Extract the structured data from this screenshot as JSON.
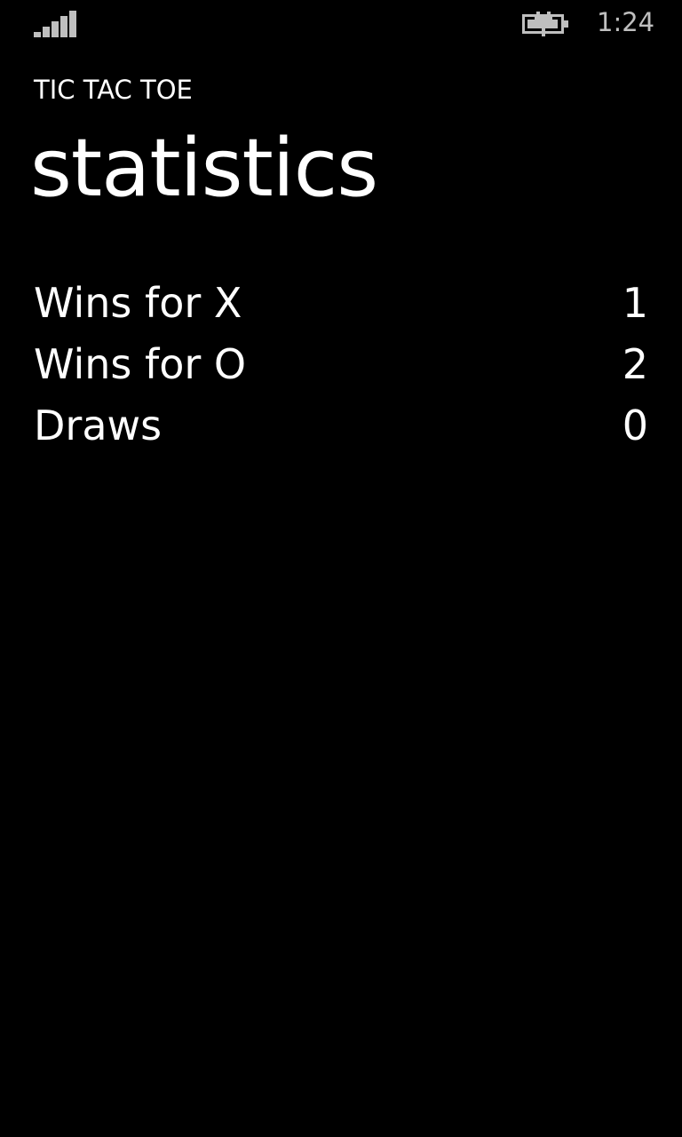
{
  "status_bar": {
    "time": "1:24",
    "signal_icon": "signal-strength-icon",
    "battery_icon": "battery-charging-icon",
    "signal_level": 1.0
  },
  "app": {
    "title": "TIC TAC TOE"
  },
  "page": {
    "title": "statistics"
  },
  "stats": [
    {
      "label": "Wins for X",
      "value": "1"
    },
    {
      "label": "Wins for O",
      "value": "2"
    },
    {
      "label": "Draws",
      "value": "0"
    }
  ],
  "colors": {
    "background": "#000000",
    "text": "#ffffff",
    "status_text": "#bfbfbf"
  }
}
